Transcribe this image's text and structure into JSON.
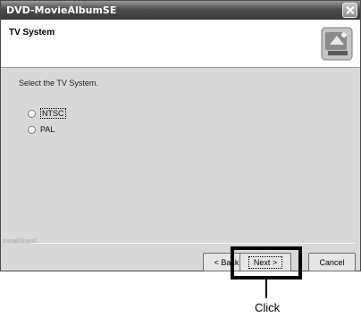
{
  "window": {
    "title": "DVD-MovieAlbumSE"
  },
  "header": {
    "title": "TV System",
    "icon": "setup-icon"
  },
  "body": {
    "instruction": "Select the TV System.",
    "options": [
      {
        "label": "NTSC",
        "selected": false,
        "focused": true
      },
      {
        "label": "PAL",
        "selected": false,
        "focused": false
      }
    ]
  },
  "footer": {
    "installshield": "InstallShield"
  },
  "buttons": {
    "back": "< Back",
    "next": "Next >",
    "cancel": "Cancel"
  },
  "annotation": {
    "callout": "Click"
  }
}
